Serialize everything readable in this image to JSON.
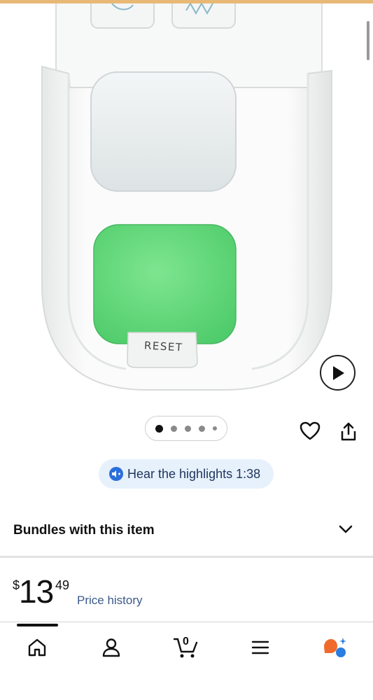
{
  "product_image": {
    "button_label": "RESET",
    "colors": {
      "green_button": "#5fd87a",
      "top_button": "#e9eeef",
      "body": "#f4f5f5"
    }
  },
  "carousel": {
    "dot_count": 5,
    "active_index": 0
  },
  "highlights": {
    "label": "Hear the highlights 1:38"
  },
  "bundles": {
    "title": "Bundles with this item"
  },
  "price": {
    "currency": "$",
    "whole": "13",
    "cents": "49",
    "history_link": "Price history"
  },
  "tabs": {
    "icons": [
      "home-icon",
      "account-icon",
      "cart-icon",
      "menu-icon",
      "ai-assistant-icon"
    ],
    "cart_count": "0",
    "active": "home"
  },
  "accent_colors": {
    "link": "#3a5a8a",
    "pill_bg": "#e6f1fc",
    "pill_icon": "#2a6fdb",
    "assistant_orange": "#f06a2b",
    "assistant_blue": "#2a7de1"
  }
}
